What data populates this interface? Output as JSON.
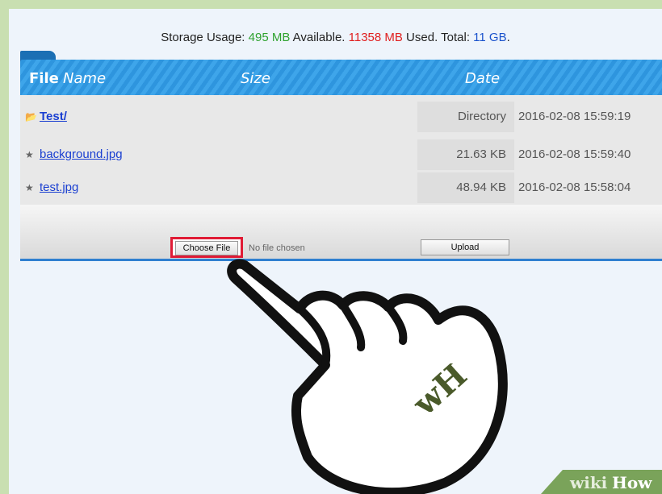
{
  "storage": {
    "prefix": "Storage Usage: ",
    "available_value": "495 MB",
    "available_label": " Available. ",
    "used_value": "11358 MB",
    "used_label": " Used. Total: ",
    "total_value": "11 GB",
    "total_suffix": ".",
    "colors": {
      "available": "#2fa22f",
      "used": "#e02020",
      "total": "#1a52cc"
    }
  },
  "table": {
    "header": {
      "file": "File",
      "name": "Name",
      "size": "Size",
      "date": "Date"
    },
    "rows": [
      {
        "icon": "folder-icon",
        "name": "Test/",
        "size": "Directory",
        "date": "2016-02-08 15:59:19"
      },
      {
        "icon": "file-icon",
        "name": "background.jpg",
        "size": "21.63 KB",
        "date": "2016-02-08 15:59:40"
      },
      {
        "icon": "file-icon",
        "name": "test.jpg",
        "size": "48.94 KB",
        "date": "2016-02-08 15:58:04"
      }
    ]
  },
  "upload_form": {
    "choose_label": "Choose File",
    "no_file_label": "No file chosen",
    "upload_label": "Upload",
    "highlight_color": "#e01b35"
  },
  "overlay": {
    "hand": "pointing-hand-icon",
    "hand_logo": "wH",
    "watermark_wiki": "wiki",
    "watermark_how": "How"
  }
}
